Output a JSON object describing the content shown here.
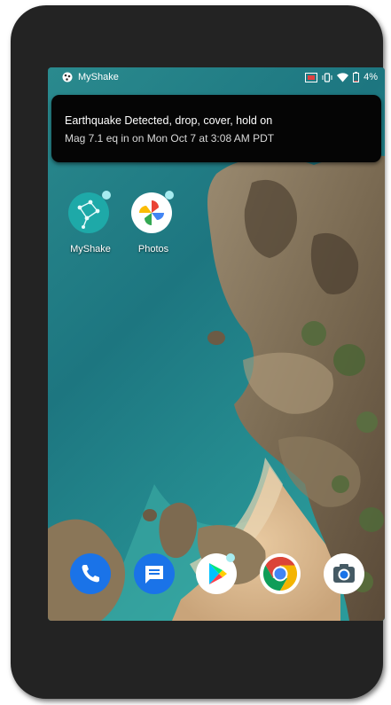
{
  "status_bar": {
    "app_name": "MyShake",
    "battery": "4%"
  },
  "notification": {
    "title": "Earthquake Detected, drop, cover, hold on",
    "body": "Mag 7.1 eq in  on Mon Oct 7 at 3:08 AM PDT"
  },
  "home_apps": [
    {
      "label": "MyShake",
      "icon": "myshake-icon"
    },
    {
      "label": "Photos",
      "icon": "photos-icon"
    }
  ],
  "dock": [
    {
      "icon": "phone-icon",
      "color": "#1a73e8"
    },
    {
      "icon": "messages-icon",
      "color": "#1a73e8"
    },
    {
      "icon": "play-store-icon",
      "color": "#ffffff"
    },
    {
      "icon": "chrome-icon",
      "color": "#ffffff"
    },
    {
      "icon": "camera-icon",
      "color": "#ffffff"
    }
  ]
}
